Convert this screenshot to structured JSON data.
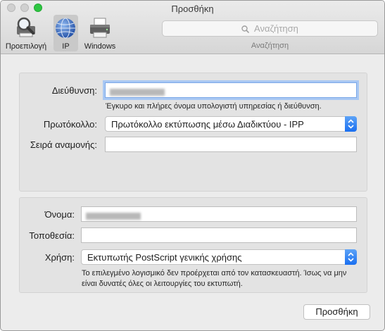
{
  "window": {
    "title": "Προσθήκη"
  },
  "toolbar": {
    "items": [
      {
        "label": "Προεπιλογή",
        "icon": "magnifier-printer-icon"
      },
      {
        "label": "IP",
        "icon": "globe-icon",
        "selected": true
      },
      {
        "label": "Windows",
        "icon": "printer-icon"
      }
    ],
    "search": {
      "placeholder": "Αναζήτηση",
      "caption": "Αναζήτηση"
    }
  },
  "connection": {
    "address_label": "Διεύθυνση:",
    "address_hint": "Έγκυρο και πλήρες όνομα υπολογιστή υπηρεσίας ή διεύθυνση.",
    "protocol_label": "Πρωτόκολλο:",
    "protocol_value": "Πρωτόκολλο εκτύπωσης μέσω Διαδικτύου - IPP",
    "queue_label": "Σειρά αναμονής:",
    "queue_value": ""
  },
  "printer": {
    "name_label": "Όνομα:",
    "location_label": "Τοποθεσία:",
    "location_value": "",
    "use_label": "Χρήση:",
    "use_value": "Εκτυπωτής PostScript γενικής χρήσης",
    "use_warning": "Το επιλεγμένο λογισμικό δεν προέρχεται από τον κατασκευαστή. Ίσως να μην είναι δυνατές όλες οι λειτουργίες του εκτυπωτή."
  },
  "footer": {
    "add_button": "Προσθήκη"
  },
  "colors": {
    "accent": "#1a6ff0",
    "focus_ring": "#a9c8f3",
    "zoom_button": "#2ec642"
  }
}
